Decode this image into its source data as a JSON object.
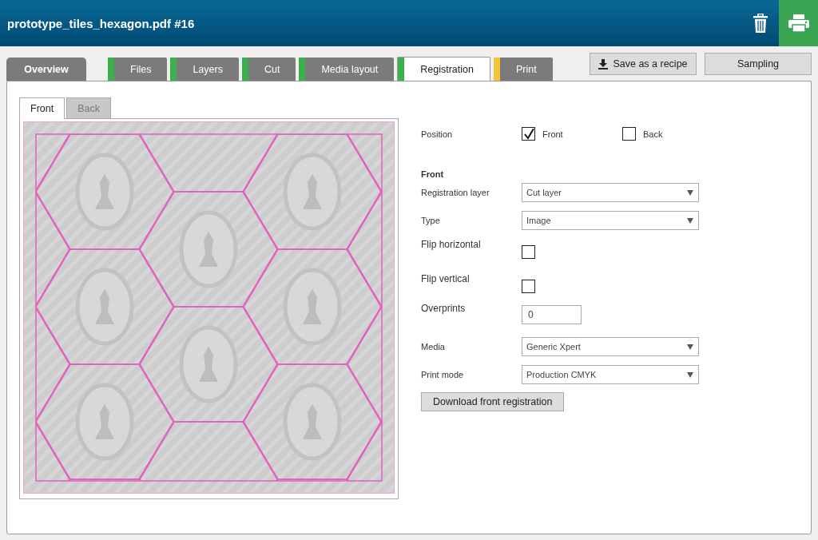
{
  "window": {
    "title": "prototype_tiles_hexagon.pdf #16"
  },
  "tabs": [
    {
      "label": "Overview",
      "selected": false
    },
    {
      "label": "Files",
      "selected": false,
      "color": "#3cb04c"
    },
    {
      "label": "Layers",
      "selected": false,
      "color": "#3cb04c"
    },
    {
      "label": "Cut",
      "selected": false,
      "color": "#3cb04c"
    },
    {
      "label": "Media layout",
      "selected": false,
      "color": "#3cb04c"
    },
    {
      "label": "Registration",
      "selected": true,
      "color": "#3cb04c"
    },
    {
      "label": "Print",
      "selected": false,
      "color": "#f2c53d"
    }
  ],
  "actions": [
    {
      "label": "Save as a recipe",
      "kind": "download"
    },
    {
      "label": "Sampling",
      "kind": "plain"
    }
  ],
  "view_tabs": [
    {
      "label": "Front",
      "selected": true
    },
    {
      "label": "Back",
      "selected": false
    }
  ],
  "position": {
    "label": "Position",
    "options": [
      {
        "label": "Front",
        "checked": true
      },
      {
        "label": "Back",
        "checked": false
      }
    ]
  },
  "section_title": "Front",
  "fields": [
    {
      "kind": "select",
      "label": "Registration layer",
      "value": "Cut layer"
    },
    {
      "kind": "select",
      "label": "Type",
      "value": "Image"
    },
    {
      "kind": "checkbox",
      "label": "Flip horizontal",
      "checked": false
    },
    {
      "kind": "checkbox",
      "label": "Flip vertical",
      "checked": false
    },
    {
      "kind": "number",
      "label": "Overprints",
      "value": "0"
    },
    {
      "kind": "select",
      "label": "Media",
      "value": "Generic Xpert"
    },
    {
      "kind": "select",
      "label": "Print mode",
      "value": "Production CMYK"
    }
  ],
  "download_button": "Download front registration"
}
